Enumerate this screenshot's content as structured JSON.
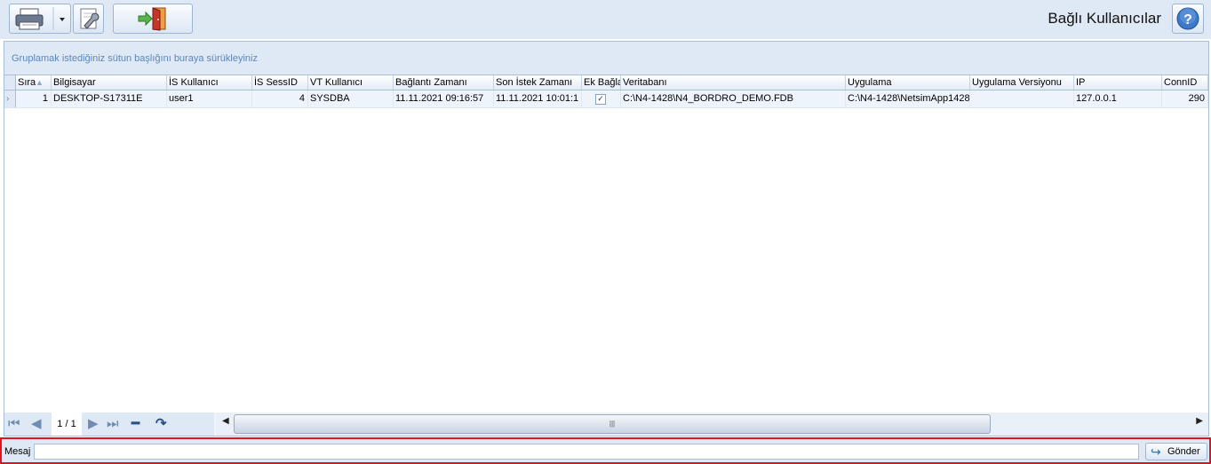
{
  "window": {
    "title": "Bağlı Kullanıcılar"
  },
  "group_hint": "Gruplamak istediğiniz sütun başlığını buraya sürükleyiniz",
  "columns": [
    {
      "label": "Sıra"
    },
    {
      "label": "Bilgisayar"
    },
    {
      "label": "İS Kullanıcı"
    },
    {
      "label": "İS SessID"
    },
    {
      "label": "VT Kullanıcı"
    },
    {
      "label": "Bağlantı Zamanı"
    },
    {
      "label": "Son İstek Zamanı"
    },
    {
      "label": "Ek Bağlantı"
    },
    {
      "label": "Veritabanı"
    },
    {
      "label": "Uygulama"
    },
    {
      "label": "Uygulama Versiyonu"
    },
    {
      "label": "IP"
    },
    {
      "label": "ConnID"
    }
  ],
  "rows": [
    {
      "sira": "1",
      "bilgisayar": "DESKTOP-S17311E",
      "is_kullanici": "user1",
      "is_sessid": "4",
      "vt_kullanici": "SYSDBA",
      "baglanti_zamani": "11.11.2021 09:16:57",
      "son_istek_zamani": "11.11.2021 10:01:1",
      "ek_baglanti": true,
      "veritabani": "C:\\N4-1428\\N4_BORDRO_DEMO.FDB",
      "uygulama": "C:\\N4-1428\\NetsimApp1428",
      "uygulama_versiyonu": "",
      "ip": "127.0.0.1",
      "connid": "290"
    }
  ],
  "pager": {
    "page": "1 / 1"
  },
  "message": {
    "label": "Mesaj",
    "value": "",
    "send_label": "Gönder"
  },
  "colors": {
    "accent": "#dfe9f5",
    "highlight_border": "#e0141e"
  }
}
